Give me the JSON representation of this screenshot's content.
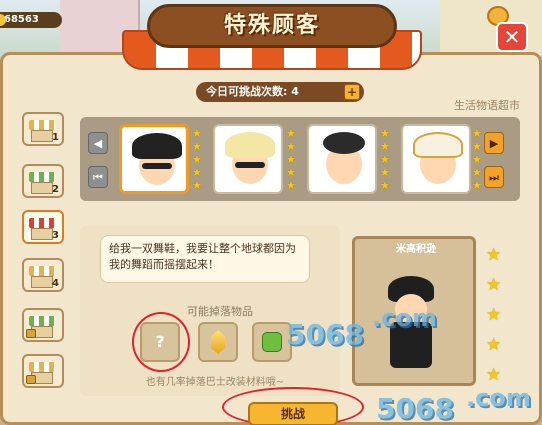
{
  "header": {
    "coins": "68563",
    "title": "特殊顾客",
    "close_symbol": "✕"
  },
  "attempts": {
    "label": "今日可挑战次数: 4",
    "plus_symbol": "+"
  },
  "market_name": "生活物语超市",
  "tabs": [
    {
      "num": "1",
      "style": "yellow",
      "locked": true
    },
    {
      "num": "2",
      "style": "green",
      "locked": false
    },
    {
      "num": "3",
      "style": "red",
      "locked": false
    },
    {
      "num": "4",
      "style": "yellow",
      "locked": false
    },
    {
      "num": "",
      "style": "green",
      "locked": true
    },
    {
      "num": "",
      "style": "yellow",
      "locked": true
    }
  ],
  "customers": [
    {
      "id": "black-hat",
      "selected": true
    },
    {
      "id": "blonde-sunglasses",
      "selected": false
    },
    {
      "id": "dark-hair",
      "selected": false
    },
    {
      "id": "turban",
      "selected": false
    }
  ],
  "nav": {
    "prev_symbol": "◀",
    "first_symbol": "⏮",
    "next_symbol": "▶",
    "last_symbol": "⏭"
  },
  "speech_text": "给我一双舞鞋，我要让整个地球都因为我的舞蹈而摇摆起来！",
  "drops": {
    "title": "可能掉落物品",
    "note": "也有几率掉落巴士改装材料哦~",
    "items": [
      {
        "icon": "question-mark",
        "label": "?"
      },
      {
        "icon": "crystal",
        "label": ""
      },
      {
        "icon": "thumbs-up",
        "label": ""
      }
    ]
  },
  "portrait": {
    "name": "米高积逊"
  },
  "challenge_button": "挑战",
  "star_glyph": "★",
  "watermarks": [
    "5068",
    ".com",
    "5068",
    ".com"
  ],
  "colors": {
    "accent": "#f09a22",
    "panel": "#f2e6cc",
    "highlight_circle": "#e5202a"
  }
}
